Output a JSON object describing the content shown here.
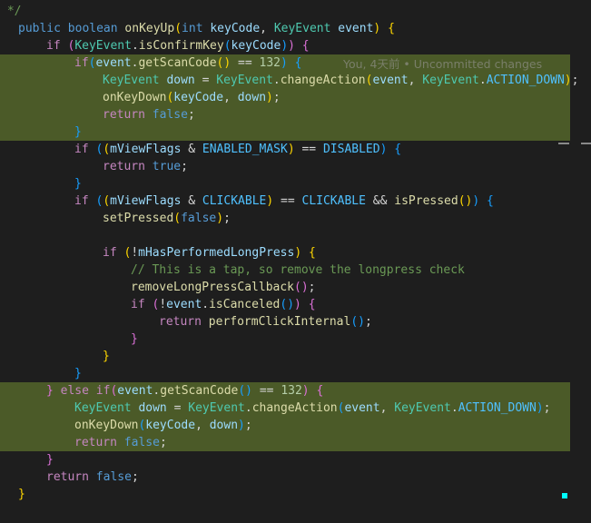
{
  "editor": {
    "colors": {
      "background": "#1e1e1e",
      "diff_highlight": "#4b5a28"
    },
    "blame_annotation": "You, 4天前 • Uncommitted changes",
    "lines": [
      {
        "tokens": [
          [
            "cm",
            " */"
          ]
        ]
      },
      {
        "tokens": [
          [
            "k",
            "public"
          ],
          [
            "",
            ""
          ],
          [
            "",
            " "
          ],
          [
            "k",
            "boolean"
          ],
          [
            "",
            " "
          ],
          [
            "f",
            "onKeyUp"
          ],
          [
            "p1",
            "("
          ],
          [
            "k",
            "int"
          ],
          [
            "",
            " "
          ],
          [
            "v",
            "keyCode"
          ],
          [
            "",
            " , "
          ],
          [
            "t",
            "KeyEvent"
          ],
          [
            "",
            " "
          ],
          [
            "v",
            "event"
          ],
          [
            "p1",
            ")"
          ],
          [
            "",
            " "
          ],
          [
            "p1",
            "{"
          ]
        ]
      },
      {
        "tokens": [
          [
            "",
            " "
          ]
        ]
      }
    ],
    "code": [
      " */",
      "public boolean onKeyUp(int keyCode, KeyEvent event) {",
      "    if (KeyEvent.isConfirmKey(keyCode)) {",
      "        if(event.getScanCode() == 132) {",
      "            KeyEvent down = KeyEvent.changeAction(event, KeyEvent.ACTION_DOWN);",
      "            onKeyDown(keyCode, down);",
      "            return false;",
      "        }",
      "        if ((mViewFlags & ENABLED_MASK) == DISABLED) {",
      "            return true;",
      "        }",
      "        if ((mViewFlags & CLICKABLE) == CLICKABLE && isPressed()) {",
      "            setPressed(false);",
      "",
      "            if (!mHasPerformedLongPress) {",
      "                // This is a tap, so remove the longpress check",
      "                removeLongPressCallback();",
      "                if (!event.isCanceled()) {",
      "                    return performClickInternal();",
      "                }",
      "            }",
      "        }",
      "    } else if(event.getScanCode() == 132) {",
      "        KeyEvent down = KeyEvent.changeAction(event, KeyEvent.ACTION_DOWN);",
      "        onKeyDown(keyCode, down);",
      "        return false;",
      "    }",
      "    return false;",
      "}"
    ]
  }
}
